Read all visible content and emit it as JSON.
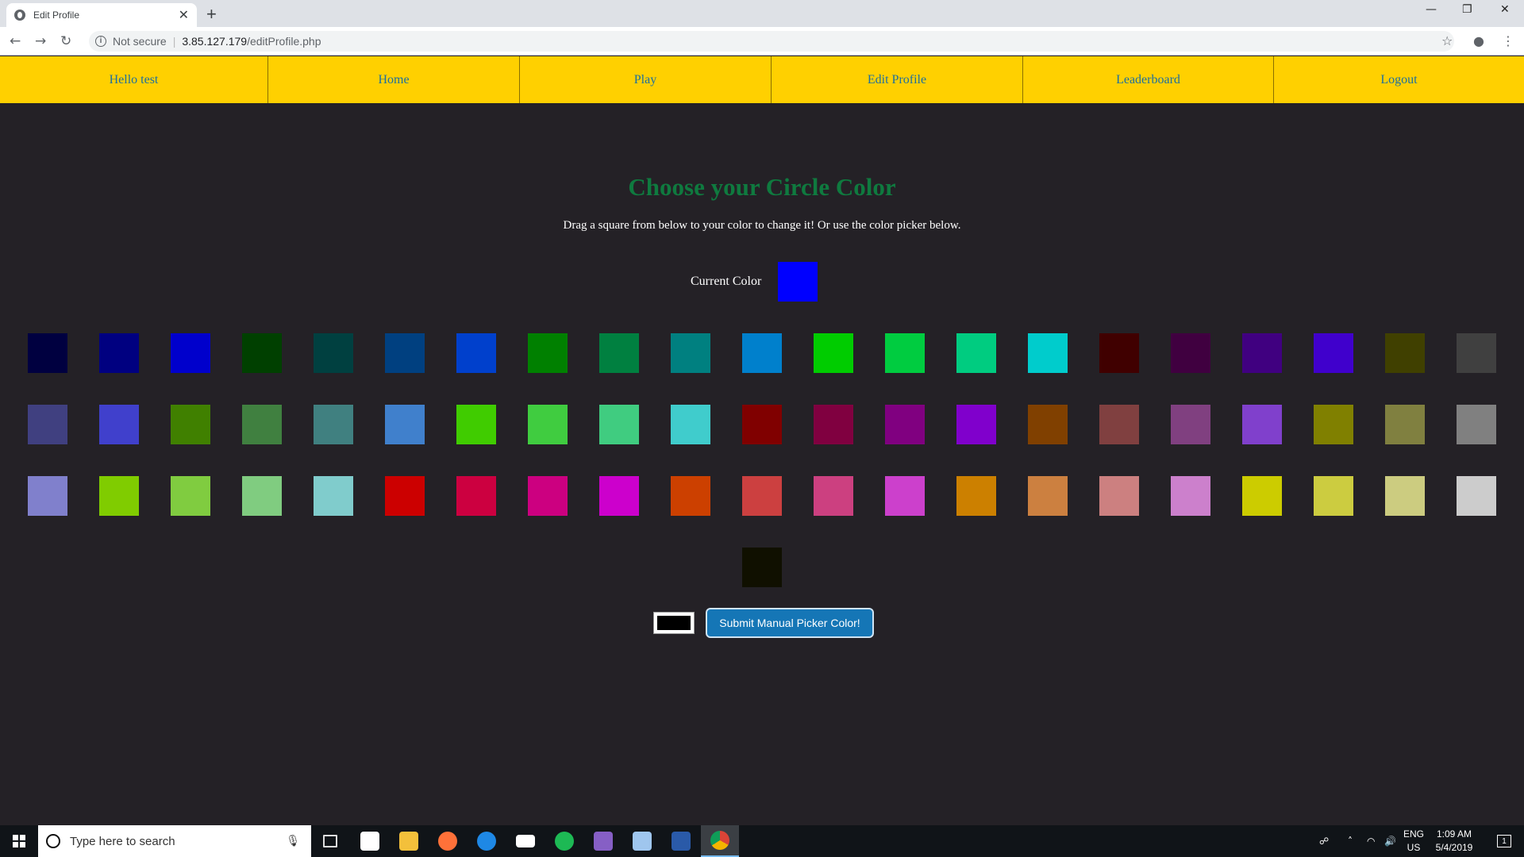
{
  "browser": {
    "tab_title": "Edit Profile",
    "tab_close": "✕",
    "new_tab": "+",
    "security_label": "Not secure",
    "url_host": "3.85.127.179",
    "url_path": "/editProfile.php"
  },
  "nav": {
    "items": [
      {
        "label": "Hello test"
      },
      {
        "label": "Home"
      },
      {
        "label": "Play"
      },
      {
        "label": "Edit Profile"
      },
      {
        "label": "Leaderboard"
      },
      {
        "label": "Logout"
      }
    ]
  },
  "main": {
    "heading": "Choose your Circle Color",
    "instructions": "Drag a square from below to your color to change it! Or use the color picker below.",
    "current_color_label": "Current Color",
    "current_color": "#0000ff",
    "palette_rows": [
      [
        "#000040",
        "#000080",
        "#0000cc",
        "#004000",
        "#004040",
        "#004080",
        "#0040cc",
        "#008000",
        "#008040",
        "#008080",
        "#0080cc",
        "#00cc00",
        "#00cc40",
        "#00cc80",
        "#00cccc",
        "#400000",
        "#400040",
        "#400080",
        "#4000cc",
        "#404000",
        "#404040"
      ],
      [
        "#404080",
        "#4040cc",
        "#408000",
        "#408040",
        "#408080",
        "#4080cc",
        "#40cc00",
        "#40cc40",
        "#40cc80",
        "#40cccc",
        "#800000",
        "#800040",
        "#800080",
        "#8000cc",
        "#804000",
        "#804040",
        "#804080",
        "#8040cc",
        "#808000",
        "#808040",
        "#808080"
      ],
      [
        "#8080cc",
        "#80cc00",
        "#80cc40",
        "#80cc80",
        "#80cccc",
        "#cc0000",
        "#cc0040",
        "#cc0080",
        "#cc00cc",
        "#cc4000",
        "#cc4040",
        "#cc4080",
        "#cc40cc",
        "#cc8000",
        "#cc8040",
        "#cc8080",
        "#cc80cc",
        "#cccc00",
        "#cccc40",
        "#cccc80",
        "#cccccc"
      ],
      [
        "#101000"
      ]
    ],
    "picker_value": "#000000",
    "submit_label": "Submit Manual Picker Color!"
  },
  "taskbar": {
    "search_placeholder": "Type here to search",
    "lang_top": "ENG",
    "lang_bottom": "US",
    "time": "1:09 AM",
    "date": "5/4/2019",
    "notification_count": "1"
  }
}
